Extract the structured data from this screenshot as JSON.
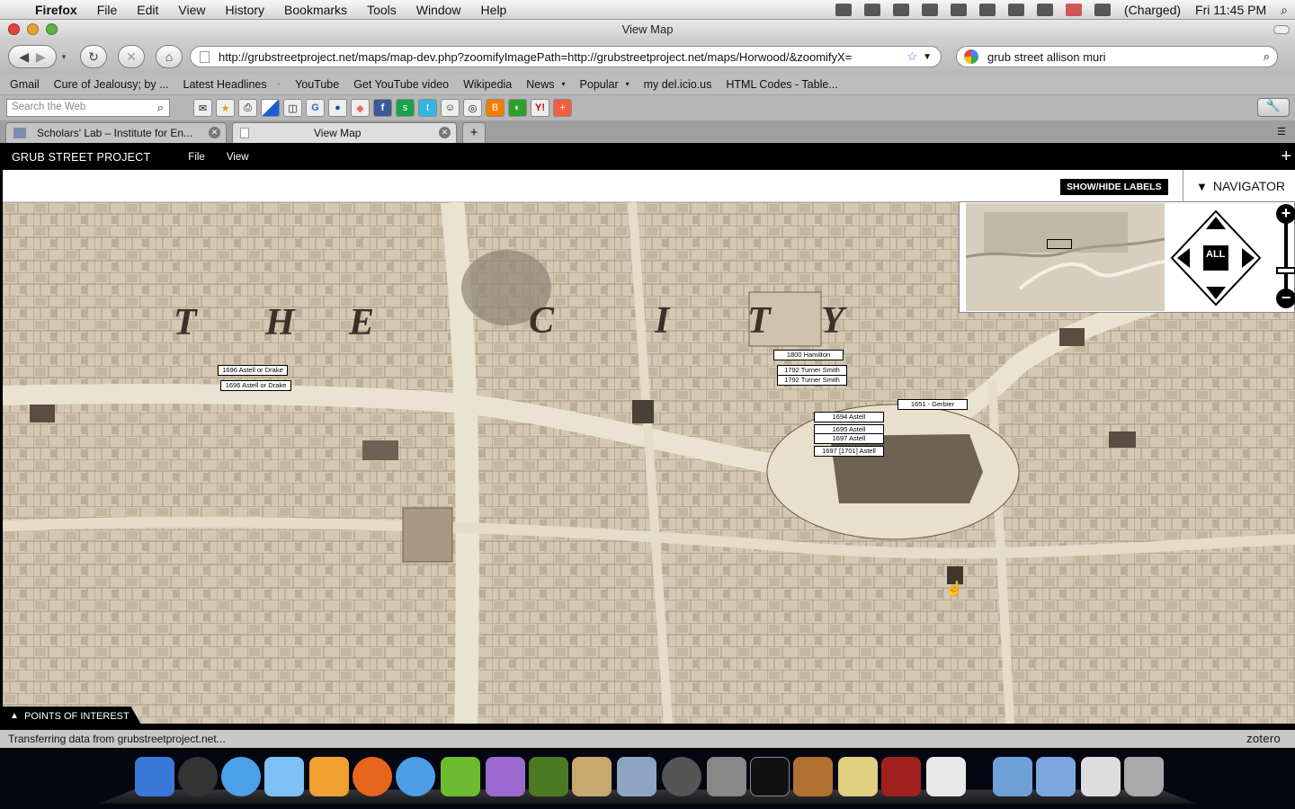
{
  "menubar": {
    "app": "Firefox",
    "items": [
      "File",
      "Edit",
      "View",
      "History",
      "Bookmarks",
      "Tools",
      "Window",
      "Help"
    ],
    "battery": "(Charged)",
    "clock": "Fri 11:45 PM"
  },
  "window": {
    "title": "View Map"
  },
  "navbar": {
    "url": "http://grubstreetproject.net/maps/map-dev.php?zoomifyImagePath=http://grubstreetproject.net/maps/Horwood/&zoomifyX=",
    "search_value": "grub street allison muri"
  },
  "bookmarks": [
    "Gmail",
    "Cure of Jealousy; by ...",
    "Latest Headlines",
    "YouTube",
    "Get YouTube video",
    "Wikipedia",
    "News",
    "Popular",
    "my del.icio.us",
    "HTML Codes - Table..."
  ],
  "toolbar2": {
    "search_placeholder": "Search the Web"
  },
  "tabs": [
    {
      "label": "Scholars' Lab – Institute for En..."
    },
    {
      "label": "View Map"
    }
  ],
  "app": {
    "title": "GRUB STREET PROJECT",
    "menu": [
      "File",
      "View"
    ],
    "show_hide": "SHOW/HIDE LABELS",
    "navigator": "NAVIGATOR",
    "nav_all": "ALL",
    "poi": "POINTS OF INTEREST"
  },
  "map_labels": [
    "1696 Astell or Drake",
    "1696 Astell or Drake",
    "1800 Hamilton",
    "1792 Turner Smith",
    "1792 Turner Smith",
    "1651 - Gerbier",
    "1694 Astell",
    "1695 Astell",
    "1697 Astell",
    "1697 [1701] Astell"
  ],
  "map_letters": [
    "T",
    "H",
    "E",
    "C",
    "I",
    "T",
    "Y"
  ],
  "status": "Transferring data from grubstreetproject.net...",
  "zotero": "zotero",
  "colors": {
    "map_bg": "#d8cdb9",
    "app_bar": "#000000",
    "chrome": "#c4c4c4"
  }
}
